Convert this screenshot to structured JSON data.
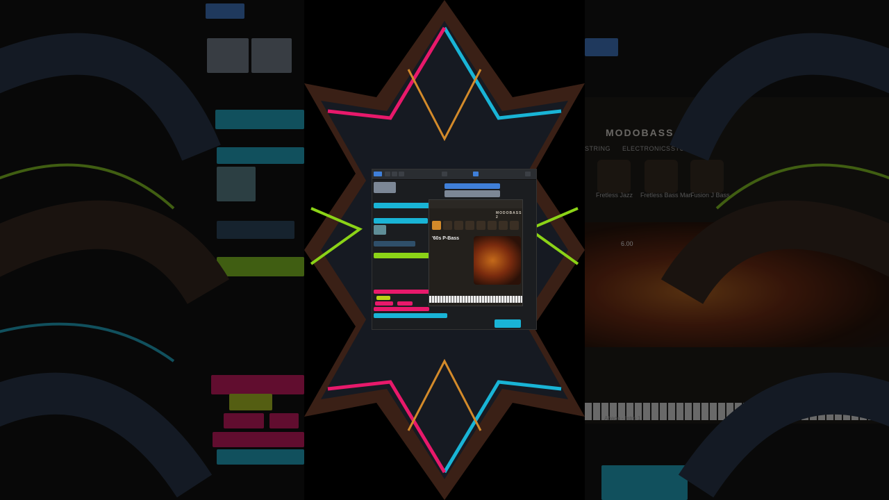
{
  "plugin": {
    "brand": "MODOBASS 2",
    "preset_name": "'60s P-Bass",
    "tabs": [
      "STRING",
      "ELECTRONICS",
      "STUDIO"
    ],
    "models": [
      "Fretless Jazz",
      "Fretless Bass Man",
      "Fusion J Bass"
    ],
    "knob_value": "6.00",
    "bottom_label": "Abaco - Intro 1"
  },
  "colors": {
    "cyan_clip": "#19b4d6",
    "pink_clip": "#e8196b",
    "lime_clip": "#8bd317",
    "blue_clip": "#3f7fd9",
    "accent_orange": "#d38a2a",
    "frame_dark": "#1b1d20"
  },
  "icons": [
    "pencil-icon",
    "eraser-icon",
    "scissors-icon",
    "play-icon",
    "settings-icon"
  ]
}
